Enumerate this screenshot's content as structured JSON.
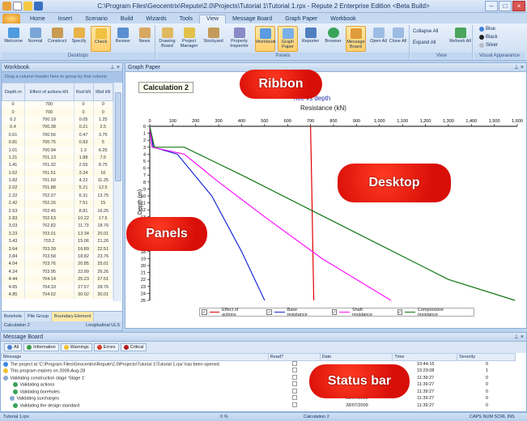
{
  "window": {
    "title": "C:\\Program Files\\Geocentrix\\Repute\\2.0\\Projects\\Tutorial 1\\Tutorial 1.rpx - Repute 2 Enterprise Edition <Beta Build>",
    "controls": [
      "–",
      "□",
      "×"
    ]
  },
  "tabs": [
    "Home",
    "Insert",
    "Scenario",
    "Build",
    "Wizards",
    "Tools",
    "View",
    "Message Board",
    "Graph Paper",
    "Workbook"
  ],
  "ribbon": {
    "desktops_group": "Desktops",
    "panels_group": "Panels",
    "view_group": "View",
    "visual_group": "Visual Appearance",
    "desktop_buttons": [
      "Welcome",
      "Normal",
      "Construct",
      "Specify",
      "Check",
      "Review",
      "News"
    ],
    "panel_buttons": [
      "Drawing Board",
      "Project Manager",
      "Stockyard",
      "Property Inspector",
      "Workbook",
      "Graph Paper",
      "Reporter",
      "Browser",
      "Message Board",
      "Open All",
      "Close All"
    ],
    "view_buttons": [
      "Collapse All",
      "Expand All",
      "Refresh All"
    ],
    "appearance": [
      "Blue",
      "Black",
      "Silver"
    ]
  },
  "workbook": {
    "title": "Workbook",
    "group_hint": "Drag a column header here to group by that column",
    "columns": [
      "Depth m",
      "Effect of actions kN",
      "Rsd kN",
      "Rbd kN"
    ],
    "rows": [
      [
        "0",
        "700",
        "0",
        "0"
      ],
      [
        "0",
        "700",
        "0",
        "0"
      ],
      [
        "0.2",
        "700.19",
        "0.05",
        "1.25"
      ],
      [
        "0.4",
        "700.38",
        "0.21",
        "2.5"
      ],
      [
        "0.61",
        "700.56",
        "0.47",
        "3.75"
      ],
      [
        "0.81",
        "700.75",
        "0.83",
        "5"
      ],
      [
        "1.01",
        "700.94",
        "1.3",
        "6.25"
      ],
      [
        "1.21",
        "701.13",
        "1.88",
        "7.5"
      ],
      [
        "1.41",
        "701.32",
        "2.55",
        "8.75"
      ],
      [
        "1.62",
        "701.51",
        "3.34",
        "10"
      ],
      [
        "1.82",
        "701.69",
        "4.22",
        "11.25"
      ],
      [
        "2.02",
        "701.88",
        "5.21",
        "12.5"
      ],
      [
        "2.22",
        "702.07",
        "6.31",
        "13.75"
      ],
      [
        "2.42",
        "702.26",
        "7.51",
        "15"
      ],
      [
        "2.63",
        "702.45",
        "8.81",
        "16.25"
      ],
      [
        "2.83",
        "702.63",
        "10.22",
        "17.5"
      ],
      [
        "3.03",
        "702.82",
        "11.73",
        "18.76"
      ],
      [
        "3.23",
        "703.01",
        "13.34",
        "20.01"
      ],
      [
        "3.43",
        "703.2",
        "15.06",
        "21.26"
      ],
      [
        "3.64",
        "703.39",
        "16.89",
        "22.51"
      ],
      [
        "3.84",
        "703.58",
        "18.82",
        "23.76"
      ],
      [
        "4.04",
        "703.76",
        "20.85",
        "25.01"
      ],
      [
        "4.24",
        "703.95",
        "22.99",
        "26.26"
      ],
      [
        "4.44",
        "704.14",
        "25.23",
        "27.51"
      ],
      [
        "4.65",
        "704.33",
        "27.57",
        "28.76"
      ],
      [
        "4.85",
        "704.52",
        "30.02",
        "30.01"
      ]
    ],
    "bottom_tabs": [
      "Borehole",
      "Pile Group",
      "Boundary Element"
    ],
    "footer_left": "Calculation 2",
    "footer_right": "Longitudinal ULS"
  },
  "graph": {
    "panel_title": "Graph Paper",
    "calc_label": "Calculation 2",
    "title_visible": "nce vs depth",
    "chart_data": {
      "type": "line",
      "title": "Resistance vs depth",
      "xlabel": "Resistance (kN)",
      "ylabel": "Depth (m)",
      "xlim": [
        0,
        1600
      ],
      "ylim": [
        0,
        25
      ],
      "xticks": [
        0,
        100,
        200,
        300,
        400,
        500,
        600,
        700,
        800,
        900,
        1000,
        1100,
        1200,
        1300,
        1400,
        1500,
        1600
      ],
      "yticks": [
        0,
        1,
        2,
        3,
        4,
        5,
        6,
        7,
        8,
        9,
        10,
        11,
        12,
        13,
        14,
        15,
        16,
        17,
        18,
        19,
        20,
        21,
        22,
        23,
        24,
        25
      ],
      "series": [
        {
          "name": "Effect of actions",
          "color": "#e00000",
          "x": [
            700,
            703,
            706,
            710,
            714
          ],
          "y": [
            0,
            5,
            10,
            18,
            25
          ]
        },
        {
          "name": "Base resistance",
          "color": "#1a2bd6",
          "x": [
            0,
            15,
            120,
            270,
            400,
            500
          ],
          "y": [
            0,
            3,
            4,
            10,
            18,
            25
          ]
        },
        {
          "name": "Shaft resistance",
          "color": "#ff10ff",
          "x": [
            0,
            10,
            150,
            300,
            500,
            750,
            1050
          ],
          "y": [
            0,
            3,
            4,
            8,
            13,
            19,
            25
          ]
        },
        {
          "name": "Compressive resistance",
          "color": "#117711",
          "x": [
            0,
            20,
            150,
            400,
            700,
            1000,
            1300,
            1590
          ],
          "y": [
            0,
            3,
            3,
            7,
            12,
            17,
            22,
            25
          ]
        }
      ],
      "legend": "bottom",
      "grid": false
    }
  },
  "messages": {
    "title": "Message Board",
    "filters": [
      "All",
      "Information",
      "Warnings",
      "Errors",
      "Critical"
    ],
    "columns": [
      "Message",
      "Read?",
      "Date",
      "Time",
      "Severity"
    ],
    "rows": [
      {
        "icon": "info",
        "text": "The project at 'C:\\Program Files\\Geocentrix\\Repute\\2.0\\Projects\\Tutorial 1\\Tutorial 1.rpx' has been opened",
        "date": "",
        "time": "10:44:15",
        "sev": "0"
      },
      {
        "icon": "warn",
        "text": "This program expires on 2009-Aug-28",
        "date": "",
        "time": "15:29:08",
        "sev": "1"
      },
      {
        "icon": "expand",
        "text": "Validating construction stage 'Stage 1'",
        "date": "",
        "time": "11:39:27",
        "sev": "0"
      },
      {
        "icon": "ok",
        "text": "Validating actions",
        "date": "",
        "time": "11:39:27",
        "sev": "0"
      },
      {
        "icon": "ok",
        "text": "Validating boreholes",
        "date": "28/07/2009",
        "time": "11:39:27",
        "sev": "0"
      },
      {
        "icon": "expand",
        "text": "Validating surcharges",
        "date": "28/07/2009",
        "time": "11:39:27",
        "sev": "0"
      },
      {
        "icon": "ok",
        "text": "Validating the design standard",
        "date": "28/07/2009",
        "time": "11:39:27",
        "sev": "0"
      }
    ]
  },
  "status": {
    "file": "Tutorial 1.rpx",
    "progress": "0 %",
    "calc": "Calculation 2",
    "right": "CAPS  NUM  SCRL  INS"
  },
  "callouts": {
    "ribbon": "Ribbon",
    "desktop": "Desktop",
    "panels": "Panels",
    "status": "Status bar"
  }
}
